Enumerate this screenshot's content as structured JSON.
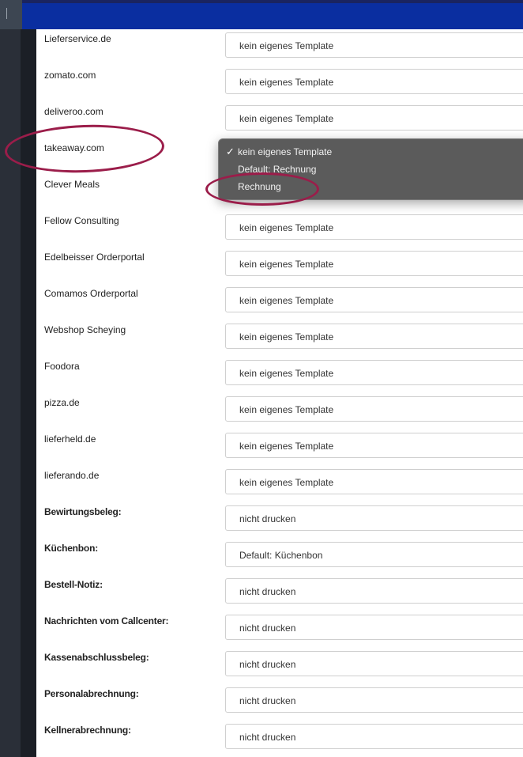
{
  "rows": [
    {
      "label": "Lieferservice.de",
      "value": "kein eigenes Template"
    },
    {
      "label": "zomato.com",
      "value": "kein eigenes Template"
    },
    {
      "label": "deliveroo.com",
      "value": "kein eigenes Template"
    },
    {
      "label": "takeaway.com",
      "value": ""
    },
    {
      "label": "Clever Meals",
      "value": ""
    },
    {
      "label": "Fellow Consulting",
      "value": "kein eigenes Template"
    },
    {
      "label": "Edelbeisser Orderportal",
      "value": "kein eigenes Template"
    },
    {
      "label": "Comamos Orderportal",
      "value": "kein eigenes Template"
    },
    {
      "label": "Webshop Scheying",
      "value": "kein eigenes Template"
    },
    {
      "label": "Foodora",
      "value": "kein eigenes Template"
    },
    {
      "label": "pizza.de",
      "value": "kein eigenes Template"
    },
    {
      "label": "lieferheld.de",
      "value": "kein eigenes Template"
    },
    {
      "label": "lieferando.de",
      "value": "kein eigenes Template"
    },
    {
      "label": "Bewirtungsbeleg:",
      "value": "nicht drucken"
    },
    {
      "label": "Küchenbon:",
      "value": "Default: Küchenbon"
    },
    {
      "label": "Bestell-Notiz:",
      "value": "nicht drucken"
    },
    {
      "label": "Nachrichten vom Callcenter:",
      "value": "nicht drucken"
    },
    {
      "label": "Kassenabschlussbeleg:",
      "value": "nicht drucken"
    },
    {
      "label": "Personalabrechnung:",
      "value": "nicht drucken"
    },
    {
      "label": "Kellnerabrechnung:",
      "value": "nicht drucken"
    }
  ],
  "dropdown": {
    "check_mark": "✓",
    "options": [
      "kein eigenes Template",
      "Default: Rechnung",
      "Rechnung"
    ],
    "selected_index": 0
  },
  "colors": {
    "topbar_accent": "#0a2ea0",
    "annotation_circle": "#9b1d4a",
    "dropdown_bg": "#5b5b5b"
  }
}
